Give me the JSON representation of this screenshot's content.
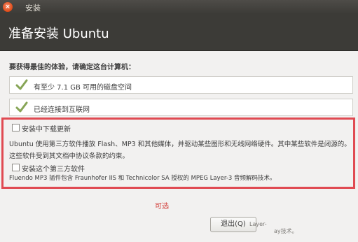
{
  "window": {
    "title": "安装",
    "close_glyph": "×"
  },
  "header": {
    "title": "准备安装 Ubuntu"
  },
  "main": {
    "intro": "要获得最佳的体验，请确定这台计算机：",
    "requirements": [
      {
        "label": "有至少 7.1 GB 可用的磁盘空间",
        "icon": "checkmark-icon",
        "met": true
      },
      {
        "label": "已经连接到互联网",
        "icon": "checkmark-icon",
        "met": true
      }
    ],
    "download_updates": {
      "label": "安装中下载更新",
      "checked": false
    },
    "third_party_description": "Ubuntu 使用第三方软件播放 Flash、MP3 和其他媒体，并驱动某些图形和无线网络硬件。其中某些软件是闭源的。这些软件受到其文档中协议条款的约束。",
    "third_party": {
      "label": "安装这个第三方软件",
      "checked": false
    },
    "fluendo_note": "Fluendo MP3 插件包含 Fraunhofer IIS 和 Technicolor SA 授权的 MPEG Layer-3 音频解码技术。",
    "annotation": "可选"
  },
  "buttons": {
    "quit_label": "退出(Q)"
  },
  "overlay_fragments": {
    "fragment1": "Layer-",
    "fragment2": "ay技术。"
  },
  "colors": {
    "titlebar": "#3c3b37",
    "highlight": "#e04a52",
    "check": "#87a556",
    "close_button": "#df4a16"
  }
}
